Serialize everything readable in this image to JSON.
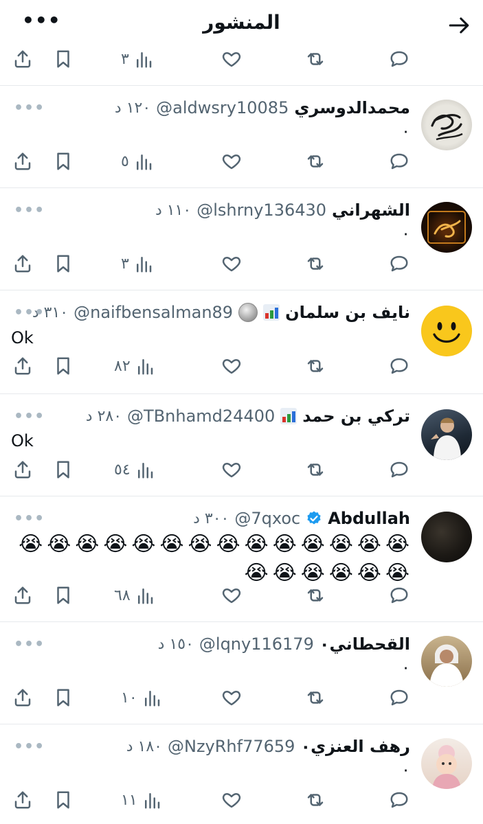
{
  "header": {
    "title": "المنشور",
    "more_icon": "more-horizontal-icon",
    "back_icon": "arrow-right-icon"
  },
  "top_partial_actions": {
    "views": "٣"
  },
  "tweets": [
    {
      "name": "محمدالدوسري",
      "handle": "@aldwsry10085",
      "time": "١٢٠ د",
      "text": "۰",
      "views": "٥",
      "avatar": "calligraphy-avatar"
    },
    {
      "name": "الشهراني",
      "handle": "@lshrny136430",
      "time": "١١٠ د",
      "text": "۰",
      "views": "٣",
      "avatar": "calligraphy-avatar-2"
    },
    {
      "name": "نايف بن سلمان",
      "handle": "@naifbensalman89",
      "time": "٣١٠ د",
      "text": "Ok",
      "views": "٨٢",
      "avatar": "smiley-avatar",
      "badges": [
        "chart-badge-icon",
        "coin-badge-icon"
      ]
    },
    {
      "name": "تركي بن حمد",
      "handle": "@TBnhamd24400",
      "time": "٢٨٠ د",
      "text": "Ok",
      "views": "٥٤",
      "avatar": "football-player-avatar",
      "badges": [
        "chart-badge-icon"
      ]
    },
    {
      "name": "Abdullah",
      "handle": "@7qxoc",
      "time": "٣٠٠ د",
      "emoji": "😭",
      "emoji_count": 20,
      "views": "٦٨",
      "avatar": "dark-photo-avatar",
      "badges": [
        "verified-badge-icon"
      ]
    },
    {
      "name": "القحطاني۰",
      "handle": "@lqny116179",
      "time": "١٥٠ د",
      "text": "۰",
      "views": "١٠",
      "avatar": "man-photo-avatar"
    },
    {
      "name": "رهف العنزي۰",
      "handle": "@NzyRhf77659",
      "time": "١٨٠ د",
      "text": "۰",
      "views": "١١",
      "avatar": "child-photo-avatar"
    }
  ],
  "colors": {
    "text": "#0f1419",
    "secondary": "#536471",
    "divider": "#e6e9ec",
    "verified": "#1d9bf0"
  }
}
